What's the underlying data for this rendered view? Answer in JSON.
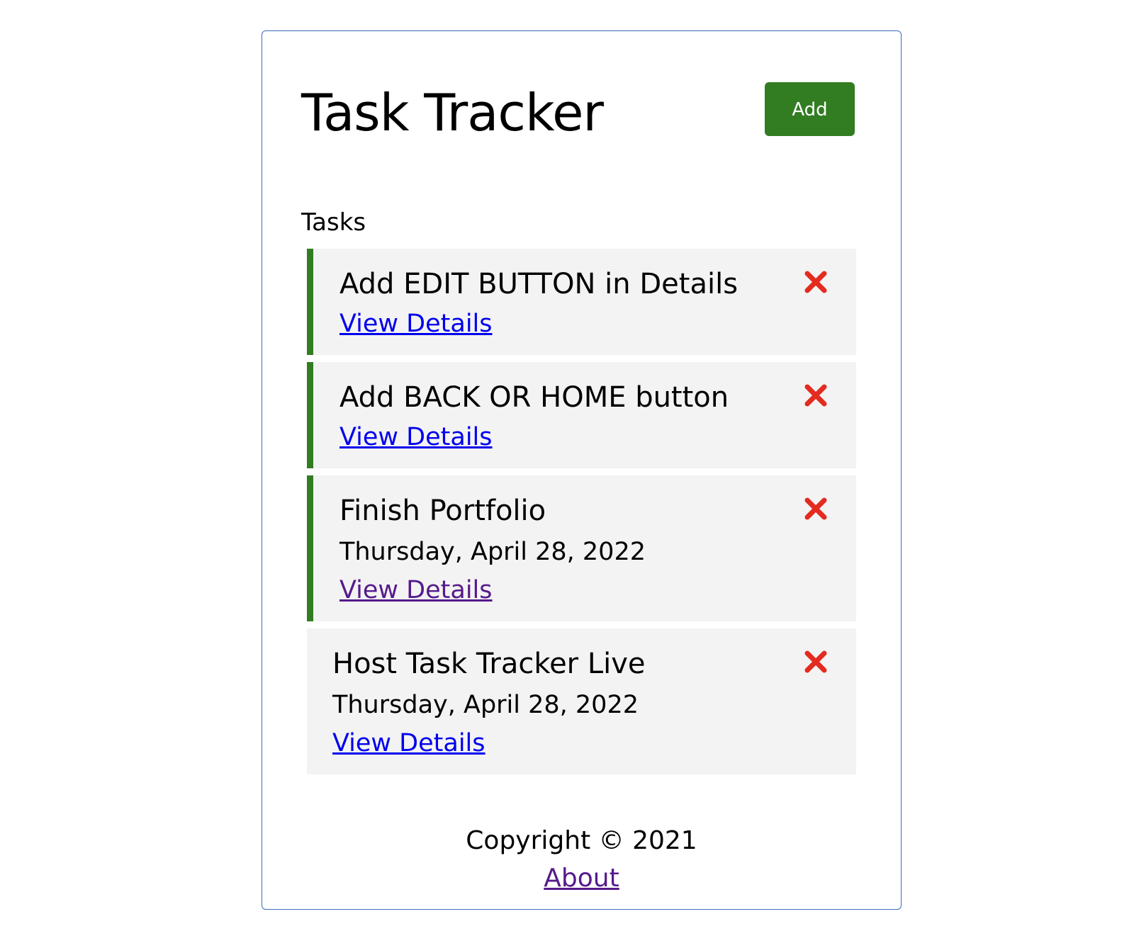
{
  "header": {
    "title": "Task Tracker",
    "add_label": "Add"
  },
  "colors": {
    "accent": "#327c22",
    "delete": "#e32b1f",
    "link": "#0000ee",
    "link_visited": "#551a8b",
    "task_bg": "#f3f3f3"
  },
  "section": {
    "label": "Tasks"
  },
  "tasks": [
    {
      "title": "Add EDIT BUTTON in Details",
      "date": "",
      "link": "View Details",
      "reminder": true,
      "icon": "close-icon"
    },
    {
      "title": "Add BACK OR HOME button",
      "date": "",
      "link": "View Details",
      "reminder": true,
      "icon": "close-icon"
    },
    {
      "title": "Finish Portfolio",
      "date": "Thursday, April 28, 2022",
      "link": "View Details",
      "reminder": true,
      "icon": "close-icon"
    },
    {
      "title": "Host Task Tracker Live",
      "date": "Thursday, April 28, 2022",
      "link": "View Details",
      "reminder": false,
      "icon": "close-icon"
    }
  ],
  "footer": {
    "copyright": "Copyright © 2021",
    "about": "About"
  }
}
